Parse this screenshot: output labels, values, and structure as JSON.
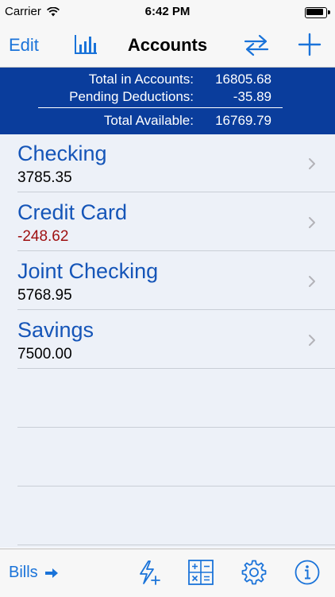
{
  "status": {
    "carrier": "Carrier",
    "time": "6:42 PM"
  },
  "nav": {
    "edit": "Edit",
    "title": "Accounts"
  },
  "summary": {
    "total_label": "Total in Accounts:",
    "total_value": "16805.68",
    "pending_label": "Pending Deductions:",
    "pending_value": "-35.89",
    "available_label": "Total Available:",
    "available_value": "16769.79"
  },
  "accounts": [
    {
      "name": "Checking",
      "balance": "3785.35"
    },
    {
      "name": "Credit Card",
      "balance": "-248.62"
    },
    {
      "name": "Joint Checking",
      "balance": "5768.95"
    },
    {
      "name": "Savings",
      "balance": "7500.00"
    }
  ],
  "toolbar": {
    "bills": "Bills"
  },
  "colors": {
    "accent": "#1a73d9",
    "summary_bg": "#0a3d9c",
    "account_name": "#1555b8",
    "negative": "#9e1010",
    "list_bg": "#edf1f8"
  },
  "icons": [
    "wifi-icon",
    "battery-icon",
    "bar-chart-icon",
    "transfer-icon",
    "add-icon",
    "chevron-right-icon",
    "arrow-right-icon",
    "quick-add-icon",
    "calculator-icon",
    "settings-icon",
    "info-icon"
  ]
}
